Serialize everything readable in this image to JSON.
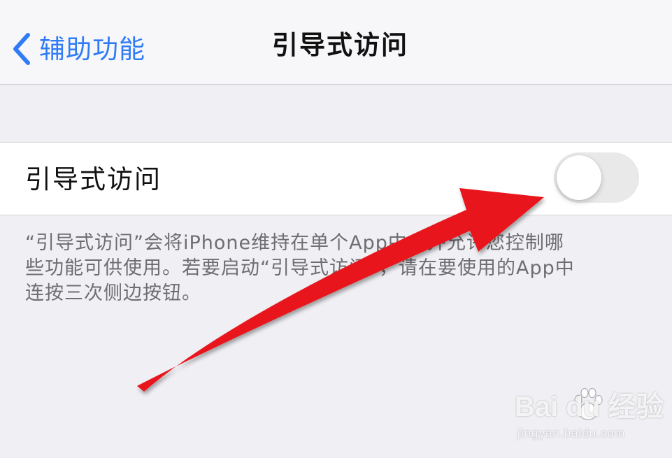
{
  "navbar": {
    "back_label": "辅助功能",
    "title": "引导式访问"
  },
  "setting": {
    "label": "引导式访问",
    "toggle_on": false
  },
  "footer": {
    "lines": [
      "“引导式访问”会将iPhone维持在单个App中，并允许您控制哪",
      "些功能可供使用。若要启动“引导式访问”，请在要使用的App中",
      "连按三次侧边按钮。"
    ]
  },
  "watermark": {
    "brand": "Bai  du 经验",
    "url": "jingyan.baidu.com"
  },
  "colors": {
    "accent": "#2f7cf6",
    "toggle_off": "#e9e9ea",
    "arrow": "#e8161b",
    "background": "#efeff4"
  },
  "icons": {
    "back": "chevron-left-icon",
    "annotation": "red-arrow-icon",
    "watermark_logo": "baidu-paw-icon"
  }
}
